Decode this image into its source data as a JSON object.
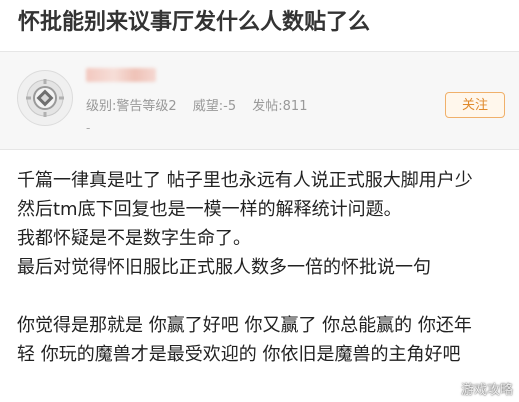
{
  "post": {
    "title": "怀批能别来议事厅发什么人数贴了么"
  },
  "author": {
    "level": "级别:警告等级2",
    "reputation": "威望:-5",
    "post_count": "发帖:811",
    "extra": "-",
    "follow_label": "关注"
  },
  "body": {
    "lines": [
      "千篇一律真是吐了 帖子里也永远有人说正式服大脚用户少",
      "然后tm底下回复也是一模一样的解释统计问题。",
      "我都怀疑是不是数字生命了。",
      "最后对觉得怀旧服比正式服人数多一倍的怀批说一句",
      "你觉得是那就是 你赢了好吧 你又赢了 你总能赢的 你还年",
      "轻 你玩的魔兽才是最受欢迎的 你依旧是魔兽的主角好吧"
    ]
  },
  "watermark": "游戏攻略"
}
